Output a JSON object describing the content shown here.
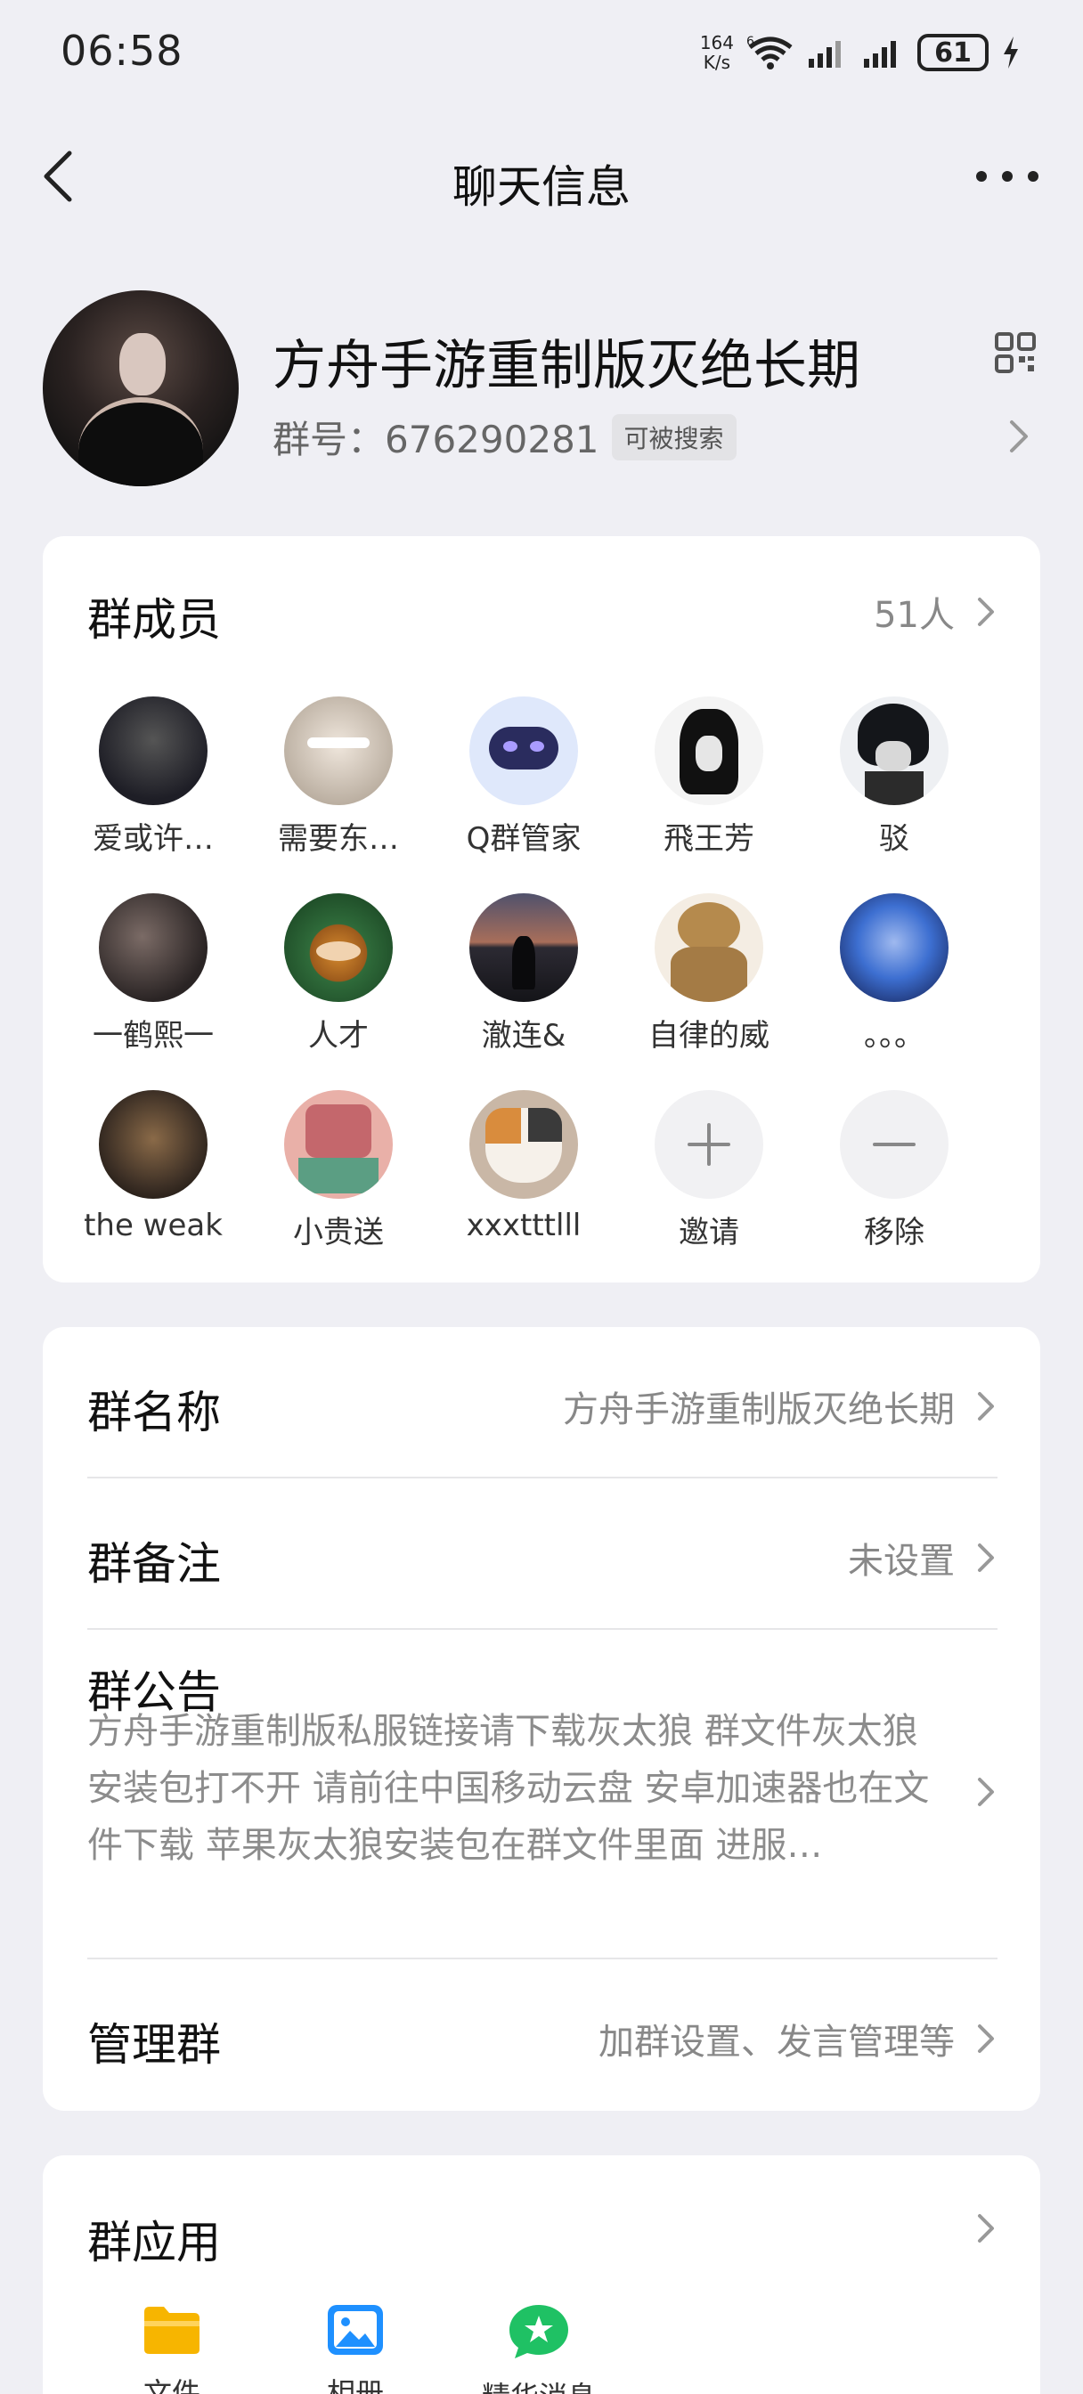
{
  "status_bar": {
    "time": "06:58",
    "net_speed_value": "164",
    "net_speed_unit": "K/s",
    "wifi_badge": "6",
    "battery": "61"
  },
  "nav": {
    "title": "聊天信息",
    "back_icon": "chevron-left-icon",
    "more_icon": "more-dots-icon"
  },
  "group": {
    "name": "方舟手游重制版灭绝长期",
    "id_label": "群号：",
    "id_value": "676290281",
    "search_badge": "可被搜索",
    "qr_icon": "qr-code-icon"
  },
  "members": {
    "title": "群成员",
    "count": "51人",
    "list": [
      {
        "name": "爱或许…",
        "color": "#2b2b33"
      },
      {
        "name": "需要东…",
        "color": "#cfc6bd"
      },
      {
        "name": "Q群管家",
        "color": "#dfe8fb"
      },
      {
        "name": "飛王芳",
        "color": "#f2f2f2"
      },
      {
        "name": "驳",
        "color": "#eceff3"
      },
      {
        "name": "一鹤熙一",
        "color": "#3a3434"
      },
      {
        "name": "人才",
        "color": "#2f6b3a"
      },
      {
        "name": "澈连&",
        "color": "#5d4a57"
      },
      {
        "name": "自律的威",
        "color": "#d9c6a7"
      },
      {
        "name": "。。。",
        "color": "#3d6fd1"
      },
      {
        "name": "the  weak",
        "color": "#3c2f25"
      },
      {
        "name": "小贵送",
        "color": "#c4676c"
      },
      {
        "name": "xxxtttlll",
        "color": "#d6b08d"
      }
    ],
    "invite_label": "邀请",
    "remove_label": "移除"
  },
  "info": {
    "group_name_label": "群名称",
    "group_name_value": "方舟手游重制版灭绝长期",
    "remark_label": "群备注",
    "remark_value": "未设置",
    "notice_label": "群公告",
    "notice_text": "方舟手游重制版私服链接请下载灰太狼 群文件灰太狼安装包打不开 请前往中国移动云盘 安卓加速器也在文件下载 苹果灰太狼安装包在群文件里面 进服…",
    "manage_label": "管理群",
    "manage_value": "加群设置、发言管理等"
  },
  "apps": {
    "title": "群应用",
    "items": [
      {
        "label": "文件",
        "icon": "folder-icon",
        "color": "#f7b500"
      },
      {
        "label": "相册",
        "icon": "photo-album-icon",
        "color": "#1e90ff"
      },
      {
        "label": "精华消息",
        "icon": "star-chat-icon",
        "color": "#1fc164"
      }
    ]
  }
}
